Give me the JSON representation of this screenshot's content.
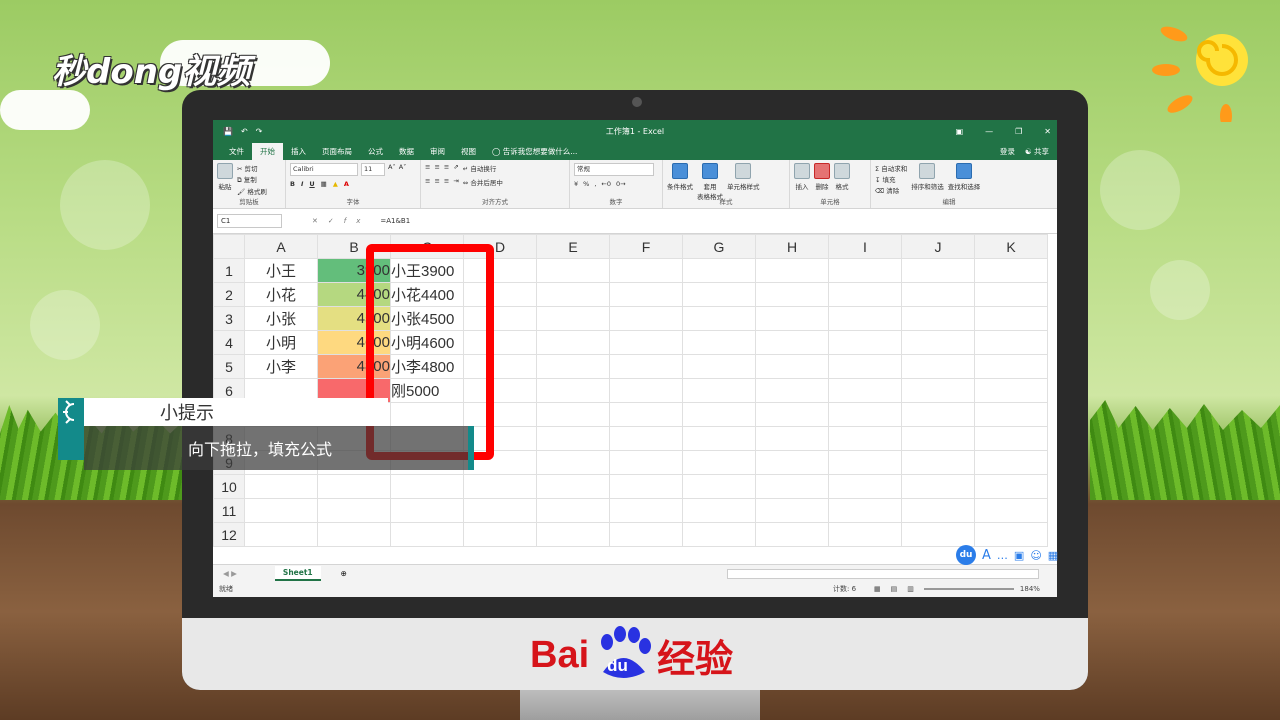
{
  "brand": {
    "top_logo": "秒dong视频",
    "bottom_logo_left": "Bai",
    "bottom_logo_paw": "du",
    "bottom_logo_right": "经验"
  },
  "excel": {
    "window_title": "工作簿1 - Excel",
    "tabs": [
      "文件",
      "开始",
      "插入",
      "页面布局",
      "公式",
      "数据",
      "审阅",
      "视图"
    ],
    "active_tab": "开始",
    "tell_me": "告诉我您想要做什么...",
    "login": "登录",
    "share": "共享",
    "ribbon": {
      "clipboard": {
        "paste": "粘贴",
        "cut": "剪切",
        "copy": "复制",
        "format_painter": "格式刷",
        "label": "剪贴板"
      },
      "font": {
        "name": "Calibri",
        "size": "11",
        "label": "字体"
      },
      "alignment": {
        "wrap": "自动换行",
        "merge": "合并后居中",
        "label": "对齐方式"
      },
      "number": {
        "format": "常规",
        "label": "数字"
      },
      "styles": {
        "conditional": "条件格式",
        "table": "套用\n表格格式",
        "cell": "单元格样式",
        "label": "样式"
      },
      "cells": {
        "insert": "插入",
        "delete": "删除",
        "format": "格式",
        "label": "单元格"
      },
      "editing": {
        "autosum": "自动求和",
        "fill": "填充",
        "clear": "清除",
        "sort": "排序和筛选",
        "find": "查找和选择",
        "label": "编辑"
      }
    },
    "name_box": "C1",
    "formula": "=A1&B1",
    "columns": [
      "A",
      "B",
      "C",
      "D",
      "E",
      "F",
      "G",
      "H",
      "I",
      "J",
      "K"
    ],
    "rows": [
      {
        "n": "1",
        "a": "小王",
        "b": "3900",
        "c": "小王3900",
        "bcolor": "#63be7b"
      },
      {
        "n": "2",
        "a": "小花",
        "b": "4400",
        "c": "小花4400",
        "bcolor": "#b5d880"
      },
      {
        "n": "3",
        "a": "小张",
        "b": "4500",
        "c": "小张4500",
        "bcolor": "#e4df82"
      },
      {
        "n": "4",
        "a": "小明",
        "b": "4600",
        "c": "小明4600",
        "bcolor": "#fed980"
      },
      {
        "n": "5",
        "a": "小李",
        "b": "4800",
        "c": "小李4800",
        "bcolor": "#fba276"
      },
      {
        "n": "6",
        "a": "",
        "b": "",
        "c": "刚5000",
        "bcolor": "#f8696b"
      },
      {
        "n": "7",
        "a": "",
        "b": "",
        "c": "",
        "bcolor": ""
      },
      {
        "n": "8",
        "a": "",
        "b": "",
        "c": "",
        "bcolor": ""
      },
      {
        "n": "9",
        "a": "",
        "b": "",
        "c": "",
        "bcolor": ""
      },
      {
        "n": "10",
        "a": "",
        "b": "",
        "c": "",
        "bcolor": ""
      },
      {
        "n": "11",
        "a": "",
        "b": "",
        "c": "",
        "bcolor": ""
      },
      {
        "n": "12",
        "a": "",
        "b": "",
        "c": "",
        "bcolor": ""
      }
    ],
    "sheet_tab": "Sheet1",
    "status_ready": "就绪",
    "status_count": "计数: 6",
    "zoom": "184%"
  },
  "tip": {
    "title": "小提示",
    "text": "向下拖拉，填充公式"
  }
}
